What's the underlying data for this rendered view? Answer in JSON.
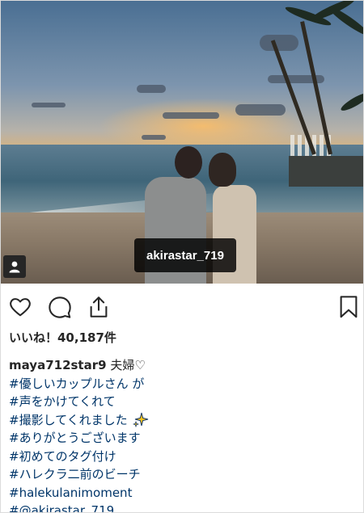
{
  "photo": {
    "tagged_user": "akirastar_719",
    "badge_icon": "user-icon"
  },
  "actions": {
    "like_icon": "heart-icon",
    "comment_icon": "comment-icon",
    "share_icon": "share-icon",
    "save_icon": "bookmark-icon"
  },
  "likes": {
    "label": "いいね！40,187件"
  },
  "caption": {
    "username": "maya712star9",
    "text": "夫婦♡",
    "lines": [
      "#優しいカップルさん が",
      "#声をかけてくれて",
      "#撮影してくれました",
      "#ありがとうございます",
      "#初めてのタグ付け",
      "#ハレクラ二前のビーチ",
      "#halekulanimoment",
      "#@akirastar_719"
    ]
  },
  "colors": {
    "hashtag": "#003569",
    "text": "#262626",
    "border": "#dbdbdb"
  }
}
